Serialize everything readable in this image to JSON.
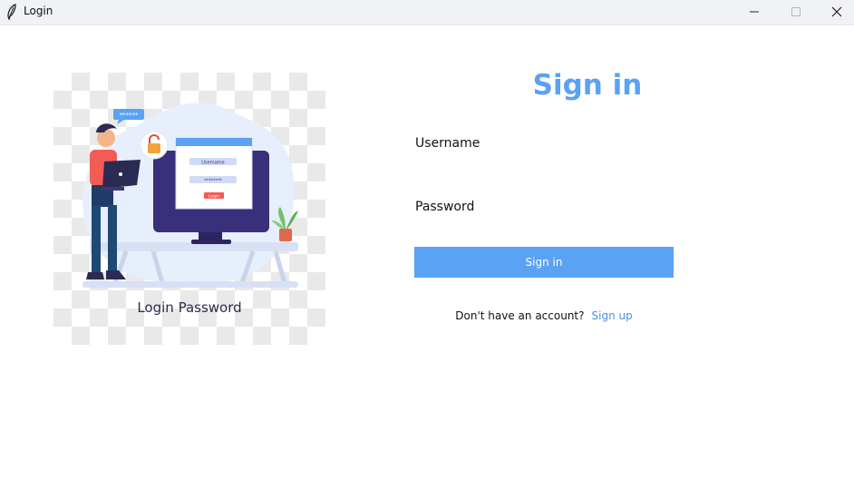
{
  "window": {
    "title": "Login",
    "controls": [
      "minimize-icon",
      "maximize-icon",
      "close-icon"
    ]
  },
  "illustration": {
    "caption": "Login Password",
    "screen_field_username": "Username",
    "screen_field_password": "********",
    "screen_button": "Login",
    "bubble_text": "******"
  },
  "form": {
    "heading": "Sign in",
    "username_label": "Username",
    "username_value": "",
    "password_label": "Password",
    "password_value": "",
    "submit_label": "Sign in",
    "signup_prompt": "Don't have an account?",
    "signup_link": "Sign up"
  },
  "colors": {
    "accent": "#5aa2f4",
    "link": "#4a90e2",
    "titlebar": "#f0f2f5"
  }
}
